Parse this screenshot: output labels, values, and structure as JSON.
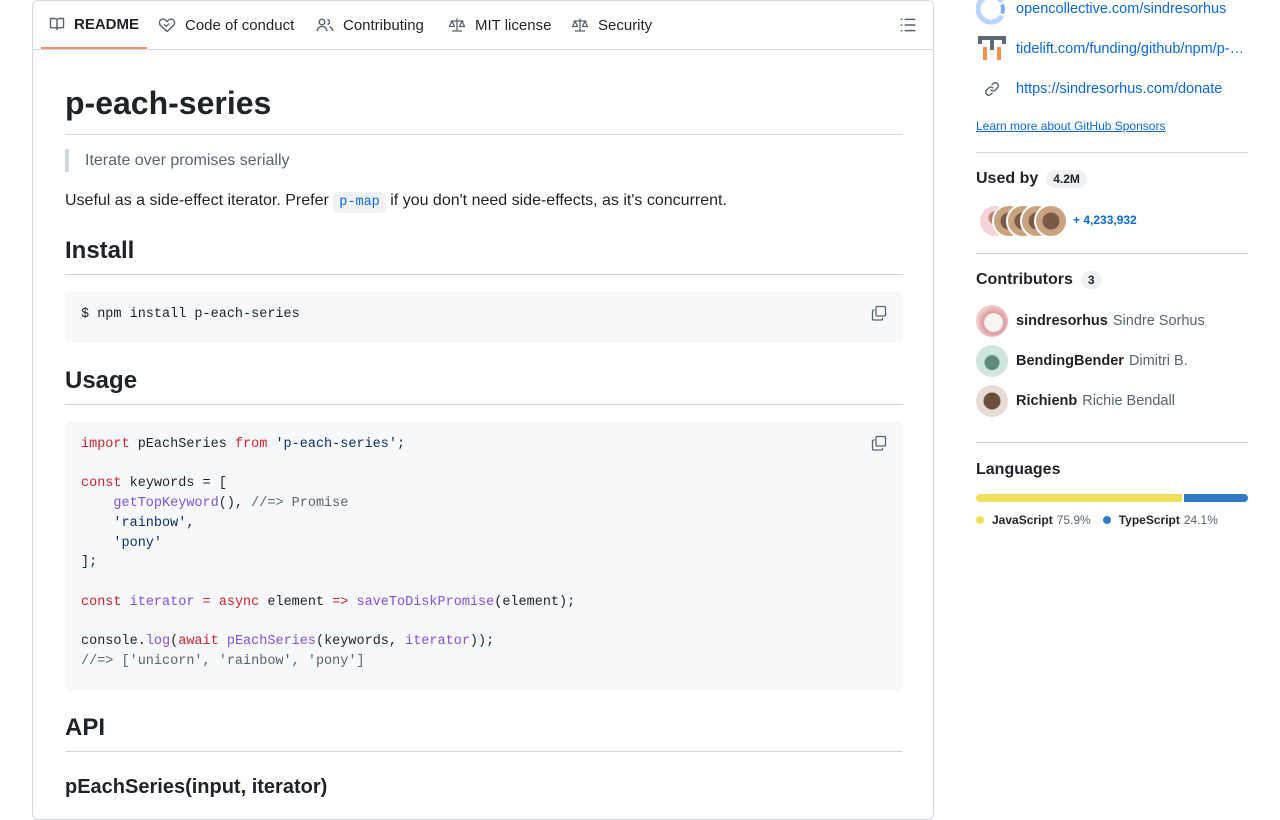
{
  "tabs": [
    {
      "label": "README",
      "active": true,
      "icon": "book-icon"
    },
    {
      "label": "Code of conduct",
      "active": false,
      "icon": "heart-handshake-icon"
    },
    {
      "label": "Contributing",
      "active": false,
      "icon": "people-icon"
    },
    {
      "label": "MIT license",
      "active": false,
      "icon": "law-icon"
    },
    {
      "label": "Security",
      "active": false,
      "icon": "law-icon"
    }
  ],
  "readme": {
    "title": "p-each-series",
    "quote": "Iterate over promises serially",
    "intro_before": "Useful as a side-effect iterator. Prefer ",
    "intro_code": "p-map",
    "intro_after": " if you don't need side-effects, as it's concurrent.",
    "install_heading": "Install",
    "install_cmd": "$ npm install p-each-series",
    "usage_heading": "Usage",
    "usage_code": {
      "import_kw": "import",
      "import_name": " pEachSeries ",
      "from_kw": "from",
      "import_src": "'p-each-series'",
      "import_end": ";",
      "const1": "const",
      "keywords_decl": " keywords = [",
      "fn_topkeyword": "getTopKeyword",
      "call_end": "(), ",
      "comment_promise": "//=> Promise",
      "str_rainbow": "'rainbow'",
      "str_pony": "'pony'",
      "close_array": "];",
      "const2": "const",
      "iterator_name": "iterator",
      "eq": " = ",
      "async_kw": "async",
      "element_param": " element ",
      "arrow": "=>",
      "fn_save": "saveToDiskPromise",
      "save_args": "(element);",
      "console": "console.",
      "log_fn": "log",
      "paren_open": "(",
      "await_kw": "await",
      "fn_peach": "pEachSeries",
      "peach_args_a": "(keywords, ",
      "peach_iterator": "iterator",
      "peach_args_b": "));",
      "result_comment": "//=> ['unicorn', 'rainbow', 'pony']"
    },
    "api_heading": "API",
    "api_sub": "pEachSeries(input, iterator)"
  },
  "sidebar": {
    "sponsors": [
      {
        "icon": "opencollective-icon",
        "url": "opencollective.com/sindresorhus"
      },
      {
        "icon": "tidelift-icon",
        "url": "tidelift.com/funding/github/npm/p-each-series"
      },
      {
        "icon": "link-icon",
        "url": "https://sindresorhus.com/donate"
      }
    ],
    "learn_more": "Learn more about GitHub Sponsors",
    "used_by": {
      "title": "Used by",
      "count": "4.2M",
      "more": "+ 4,233,932"
    },
    "contributors": {
      "title": "Contributors",
      "count": "3",
      "list": [
        {
          "login": "sindresorhus",
          "name": "Sindre Sorhus"
        },
        {
          "login": "BendingBender",
          "name": "Dimitri B."
        },
        {
          "login": "Richienb",
          "name": "Richie Bendall"
        }
      ]
    },
    "languages": {
      "title": "Languages",
      "items": [
        {
          "name": "JavaScript",
          "pct": "75.9%",
          "value": 75.9,
          "color": "#f1e05a"
        },
        {
          "name": "TypeScript",
          "pct": "24.1%",
          "value": 24.1,
          "color": "#3178c6"
        }
      ]
    }
  }
}
